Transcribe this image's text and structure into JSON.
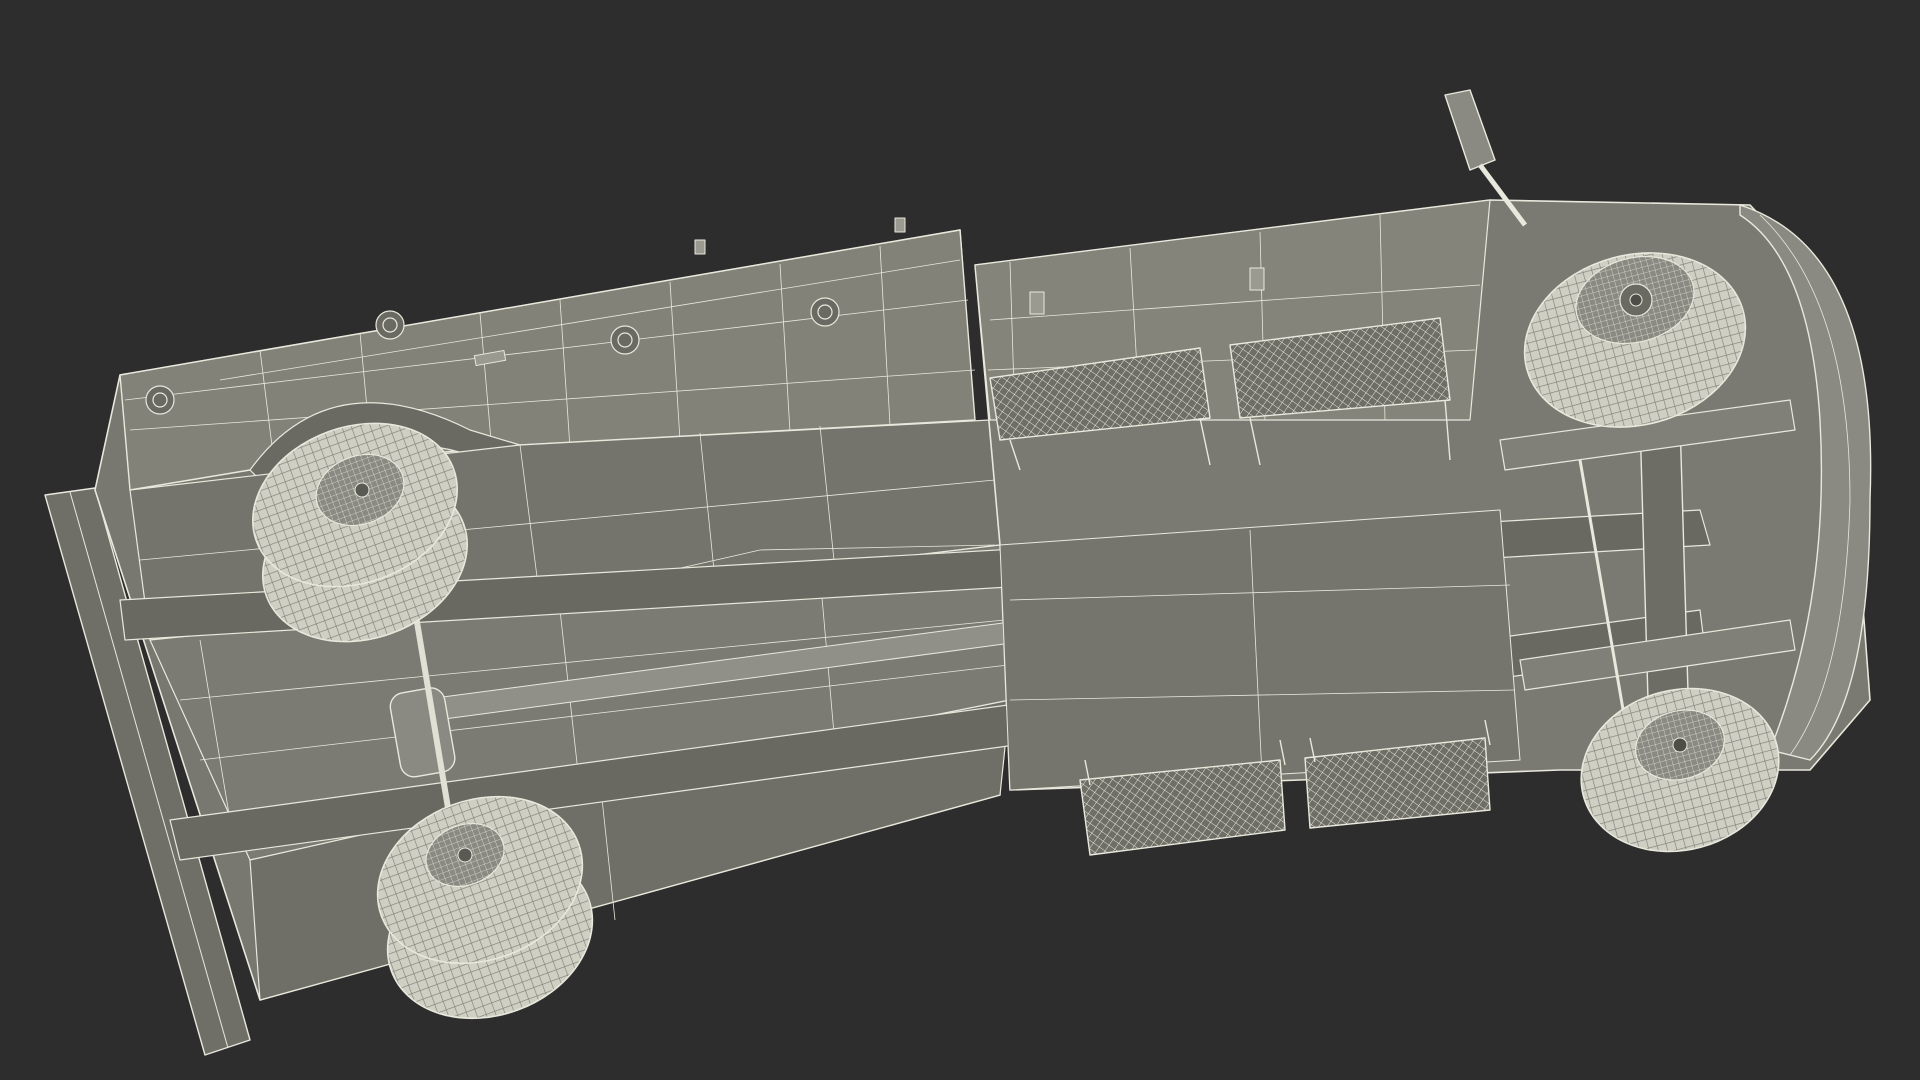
{
  "scene": {
    "subject": "truck-underside-wireframe",
    "colors": {
      "background": "#2d2d2d",
      "surface": "#787870",
      "surface_dark": "#5f5f58",
      "surface_light": "#8c8c84",
      "wire": "#e8e8dc",
      "tire": "#d9d9cf"
    }
  }
}
